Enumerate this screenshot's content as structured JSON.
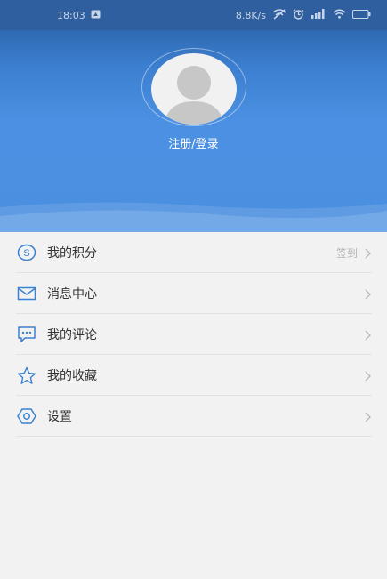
{
  "status_bar": {
    "time": "18:03",
    "net_speed": "8.8K/s",
    "icons": [
      "notification-icon",
      "signal-off-icon",
      "alarm-icon",
      "cell-signal-icon",
      "wifi-icon",
      "battery-icon"
    ]
  },
  "profile": {
    "login_label": "注册/登录",
    "avatar_icon": "default-avatar-icon"
  },
  "menu": {
    "items": [
      {
        "icon": "points-icon",
        "label": "我的积分",
        "extra": "签到"
      },
      {
        "icon": "mail-icon",
        "label": "消息中心",
        "extra": ""
      },
      {
        "icon": "comment-icon",
        "label": "我的评论",
        "extra": ""
      },
      {
        "icon": "star-icon",
        "label": "我的收藏",
        "extra": ""
      },
      {
        "icon": "settings-icon",
        "label": "设置",
        "extra": ""
      }
    ]
  },
  "colors": {
    "header_blue": "#4b8fe0",
    "icon_blue": "#3b80d2",
    "status_bar": "#2f5f9f",
    "background": "#f2f2f2"
  }
}
